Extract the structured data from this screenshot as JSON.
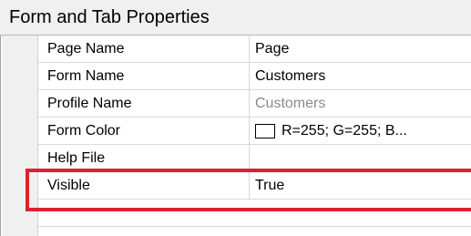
{
  "panel": {
    "title": "Form and Tab Properties"
  },
  "properties": [
    {
      "name": "Page Name",
      "value": "Page"
    },
    {
      "name": "Form Name",
      "value": "Customers"
    },
    {
      "name": "Profile Name",
      "value": "Customers"
    },
    {
      "name": "Form Color",
      "value": "R=255; G=255; B..."
    },
    {
      "name": "Help File",
      "value": ""
    },
    {
      "name": "Visible",
      "value": "True"
    }
  ],
  "colors": {
    "highlight": "#e0202a",
    "muted_value": "#8a8a8a",
    "form_color_swatch": "#ffffff"
  }
}
